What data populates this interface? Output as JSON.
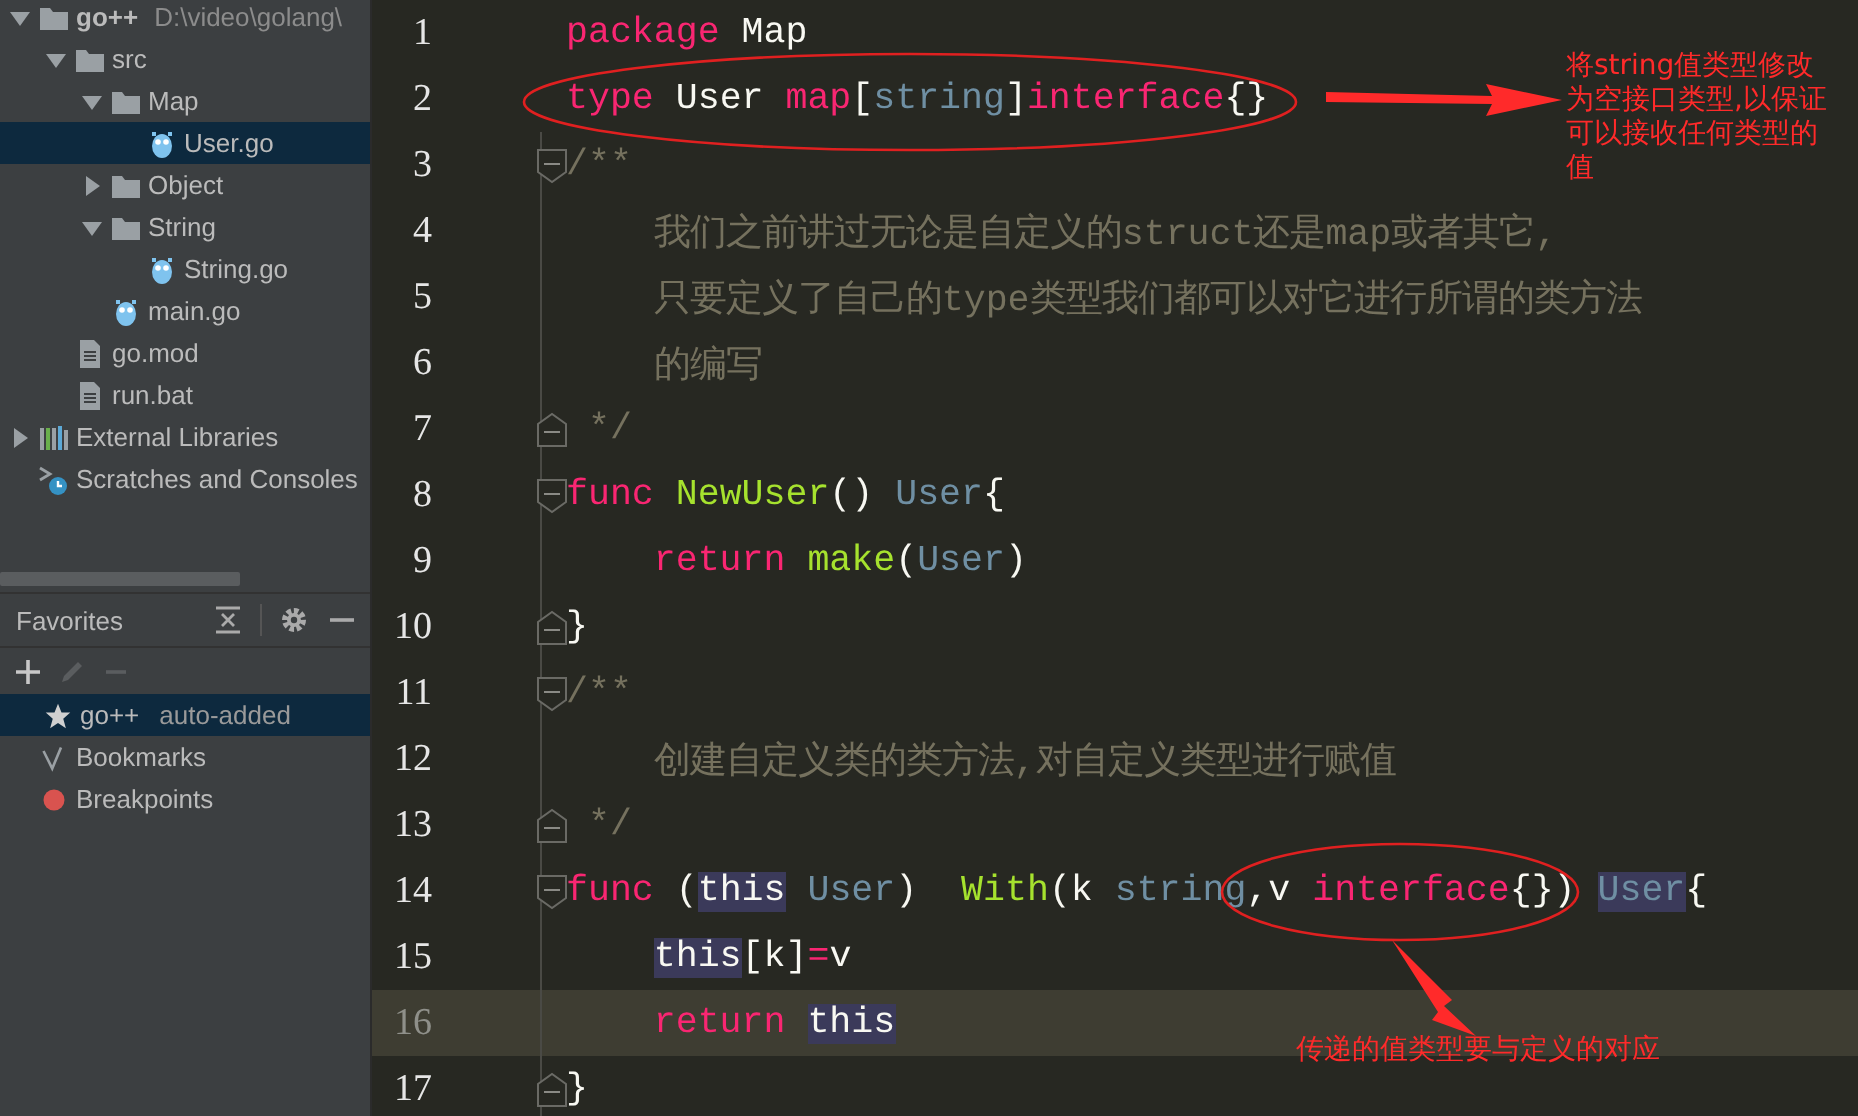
{
  "project_tree": [
    {
      "label": "go++",
      "path": "D:\\video\\golang\\",
      "kind": "folder",
      "expanded": true,
      "selected": false,
      "children": [
        {
          "label": "src",
          "kind": "folder",
          "expanded": true,
          "selected": false,
          "children": [
            {
              "label": "Map",
              "kind": "folder",
              "expanded": true,
              "selected": false,
              "children": [
                {
                  "label": "User.go",
                  "kind": "gofile",
                  "selected": true
                }
              ]
            },
            {
              "label": "Object",
              "kind": "folder",
              "expanded": false,
              "selected": false
            },
            {
              "label": "String",
              "kind": "folder",
              "expanded": true,
              "selected": false,
              "children": [
                {
                  "label": "String.go",
                  "kind": "gofile",
                  "selected": false
                }
              ]
            },
            {
              "label": "main.go",
              "kind": "gofile",
              "selected": false
            }
          ]
        },
        {
          "label": "go.mod",
          "kind": "file",
          "selected": false
        },
        {
          "label": "run.bat",
          "kind": "file",
          "selected": false
        }
      ]
    },
    {
      "label": "External Libraries",
      "kind": "library",
      "expanded": false,
      "selected": false
    },
    {
      "label": "Scratches and Consoles",
      "kind": "scratches",
      "selected": false
    }
  ],
  "favorites": {
    "title": "Favorites",
    "toolbar": [
      {
        "kind": "add",
        "disabled": false
      },
      {
        "kind": "edit",
        "disabled": true
      },
      {
        "kind": "remove",
        "disabled": true
      }
    ],
    "items": [
      {
        "label": "go++",
        "note": "auto-added",
        "selected": true
      },
      {
        "label": "Bookmarks",
        "selected": false
      },
      {
        "label": "Breakpoints",
        "selected": false
      }
    ]
  },
  "editor": {
    "lines": [
      {
        "number": "1",
        "current": false,
        "kind": "plain",
        "tokens": [
          {
            "text": "package",
            "kind": "keyword",
            "highlighted": false
          },
          {
            "text": " Map",
            "kind": "plain",
            "highlighted": false
          }
        ]
      },
      {
        "number": "2",
        "current": false,
        "kind": "plain",
        "tokens": [
          {
            "text": "type",
            "kind": "keyword",
            "highlighted": false
          },
          {
            "text": " User ",
            "kind": "plain",
            "highlighted": false
          },
          {
            "text": "map",
            "kind": "keyword",
            "highlighted": false
          },
          {
            "text": "[",
            "kind": "plain",
            "highlighted": false
          },
          {
            "text": "string",
            "kind": "type",
            "highlighted": false
          },
          {
            "text": "]",
            "kind": "plain",
            "highlighted": false
          },
          {
            "text": "interface",
            "kind": "keyword",
            "highlighted": false
          },
          {
            "text": "{}",
            "kind": "plain",
            "highlighted": false
          }
        ]
      },
      {
        "number": "3",
        "current": false,
        "kind": "foldstart",
        "tokens": [
          {
            "text": "/**",
            "kind": "comment",
            "highlighted": false
          }
        ]
      },
      {
        "number": "4",
        "current": false,
        "kind": "plain",
        "tokens": [
          {
            "text": "    我们之前讲过无论是自定义的struct还是map或者其它,",
            "kind": "comment",
            "highlighted": false
          }
        ]
      },
      {
        "number": "5",
        "current": false,
        "kind": "plain",
        "tokens": [
          {
            "text": "    只要定义了自己的type类型我们都可以对它进行所谓的类方法",
            "kind": "comment",
            "highlighted": false
          }
        ]
      },
      {
        "number": "6",
        "current": false,
        "kind": "plain",
        "tokens": [
          {
            "text": "    的编写",
            "kind": "comment",
            "highlighted": false
          }
        ]
      },
      {
        "number": "7",
        "current": false,
        "kind": "foldend",
        "tokens": [
          {
            "text": " */",
            "kind": "comment",
            "highlighted": false
          }
        ]
      },
      {
        "number": "8",
        "current": false,
        "kind": "foldstart",
        "tokens": [
          {
            "text": "func",
            "kind": "keyword",
            "highlighted": false
          },
          {
            "text": " NewUser",
            "kind": "function",
            "highlighted": false
          },
          {
            "text": "() ",
            "kind": "plain",
            "highlighted": false
          },
          {
            "text": "User",
            "kind": "type",
            "highlighted": false
          },
          {
            "text": "{",
            "kind": "plain",
            "highlighted": false
          }
        ]
      },
      {
        "number": "9",
        "current": false,
        "kind": "plain",
        "tokens": [
          {
            "text": "    return",
            "kind": "keyword",
            "highlighted": false
          },
          {
            "text": " make",
            "kind": "function",
            "highlighted": false
          },
          {
            "text": "(",
            "kind": "plain",
            "highlighted": false
          },
          {
            "text": "User",
            "kind": "type",
            "highlighted": false
          },
          {
            "text": ")",
            "kind": "plain",
            "highlighted": false
          }
        ]
      },
      {
        "number": "10",
        "current": false,
        "kind": "foldend",
        "tokens": [
          {
            "text": "}",
            "kind": "plain",
            "highlighted": false
          }
        ]
      },
      {
        "number": "11",
        "current": false,
        "kind": "foldstart",
        "tokens": [
          {
            "text": "/**",
            "kind": "comment",
            "highlighted": false
          }
        ]
      },
      {
        "number": "12",
        "current": false,
        "kind": "plain",
        "tokens": [
          {
            "text": "    创建自定义类的类方法,对自定义类型进行赋值",
            "kind": "comment",
            "highlighted": false
          }
        ]
      },
      {
        "number": "13",
        "current": false,
        "kind": "foldend",
        "tokens": [
          {
            "text": " */",
            "kind": "comment",
            "highlighted": false
          }
        ]
      },
      {
        "number": "14",
        "current": false,
        "kind": "foldstart",
        "tokens": [
          {
            "text": "func",
            "kind": "keyword",
            "highlighted": false
          },
          {
            "text": " (",
            "kind": "plain",
            "highlighted": false
          },
          {
            "text": "this",
            "kind": "plain",
            "highlighted": true
          },
          {
            "text": " User",
            "kind": "type",
            "highlighted": false
          },
          {
            "text": ")  ",
            "kind": "plain",
            "highlighted": false
          },
          {
            "text": "With",
            "kind": "function",
            "highlighted": false
          },
          {
            "text": "(k ",
            "kind": "plain",
            "highlighted": false
          },
          {
            "text": "string",
            "kind": "type",
            "highlighted": false
          },
          {
            "text": ",v ",
            "kind": "plain",
            "highlighted": false
          },
          {
            "text": "interface",
            "kind": "keyword",
            "highlighted": false
          },
          {
            "text": "{}) ",
            "kind": "plain",
            "highlighted": false
          },
          {
            "text": "User",
            "kind": "type",
            "highlighted": true
          },
          {
            "text": "{",
            "kind": "plain",
            "highlighted": false
          }
        ]
      },
      {
        "number": "15",
        "current": false,
        "kind": "plain",
        "tokens": [
          {
            "text": "    this",
            "kind": "plain",
            "highlighted": true
          },
          {
            "text": "[k]",
            "kind": "plain",
            "highlighted": false
          },
          {
            "text": "=",
            "kind": "keyword",
            "highlighted": false
          },
          {
            "text": "v",
            "kind": "plain",
            "highlighted": false
          }
        ]
      },
      {
        "number": "16",
        "current": true,
        "kind": "plain",
        "tokens": [
          {
            "text": "    return ",
            "kind": "keyword",
            "highlighted": false
          },
          {
            "text": "this",
            "kind": "plain",
            "highlighted": true
          }
        ]
      },
      {
        "number": "17",
        "current": false,
        "kind": "foldend",
        "tokens": [
          {
            "text": "}",
            "kind": "plain",
            "highlighted": false
          }
        ]
      }
    ],
    "annotations": [
      {
        "text": "将string值类型修改为空接口类型,以保证可以接收任何类型的值",
        "kind": "side"
      },
      {
        "text": "传递的值类型要与定义的对应",
        "kind": "below"
      }
    ]
  }
}
